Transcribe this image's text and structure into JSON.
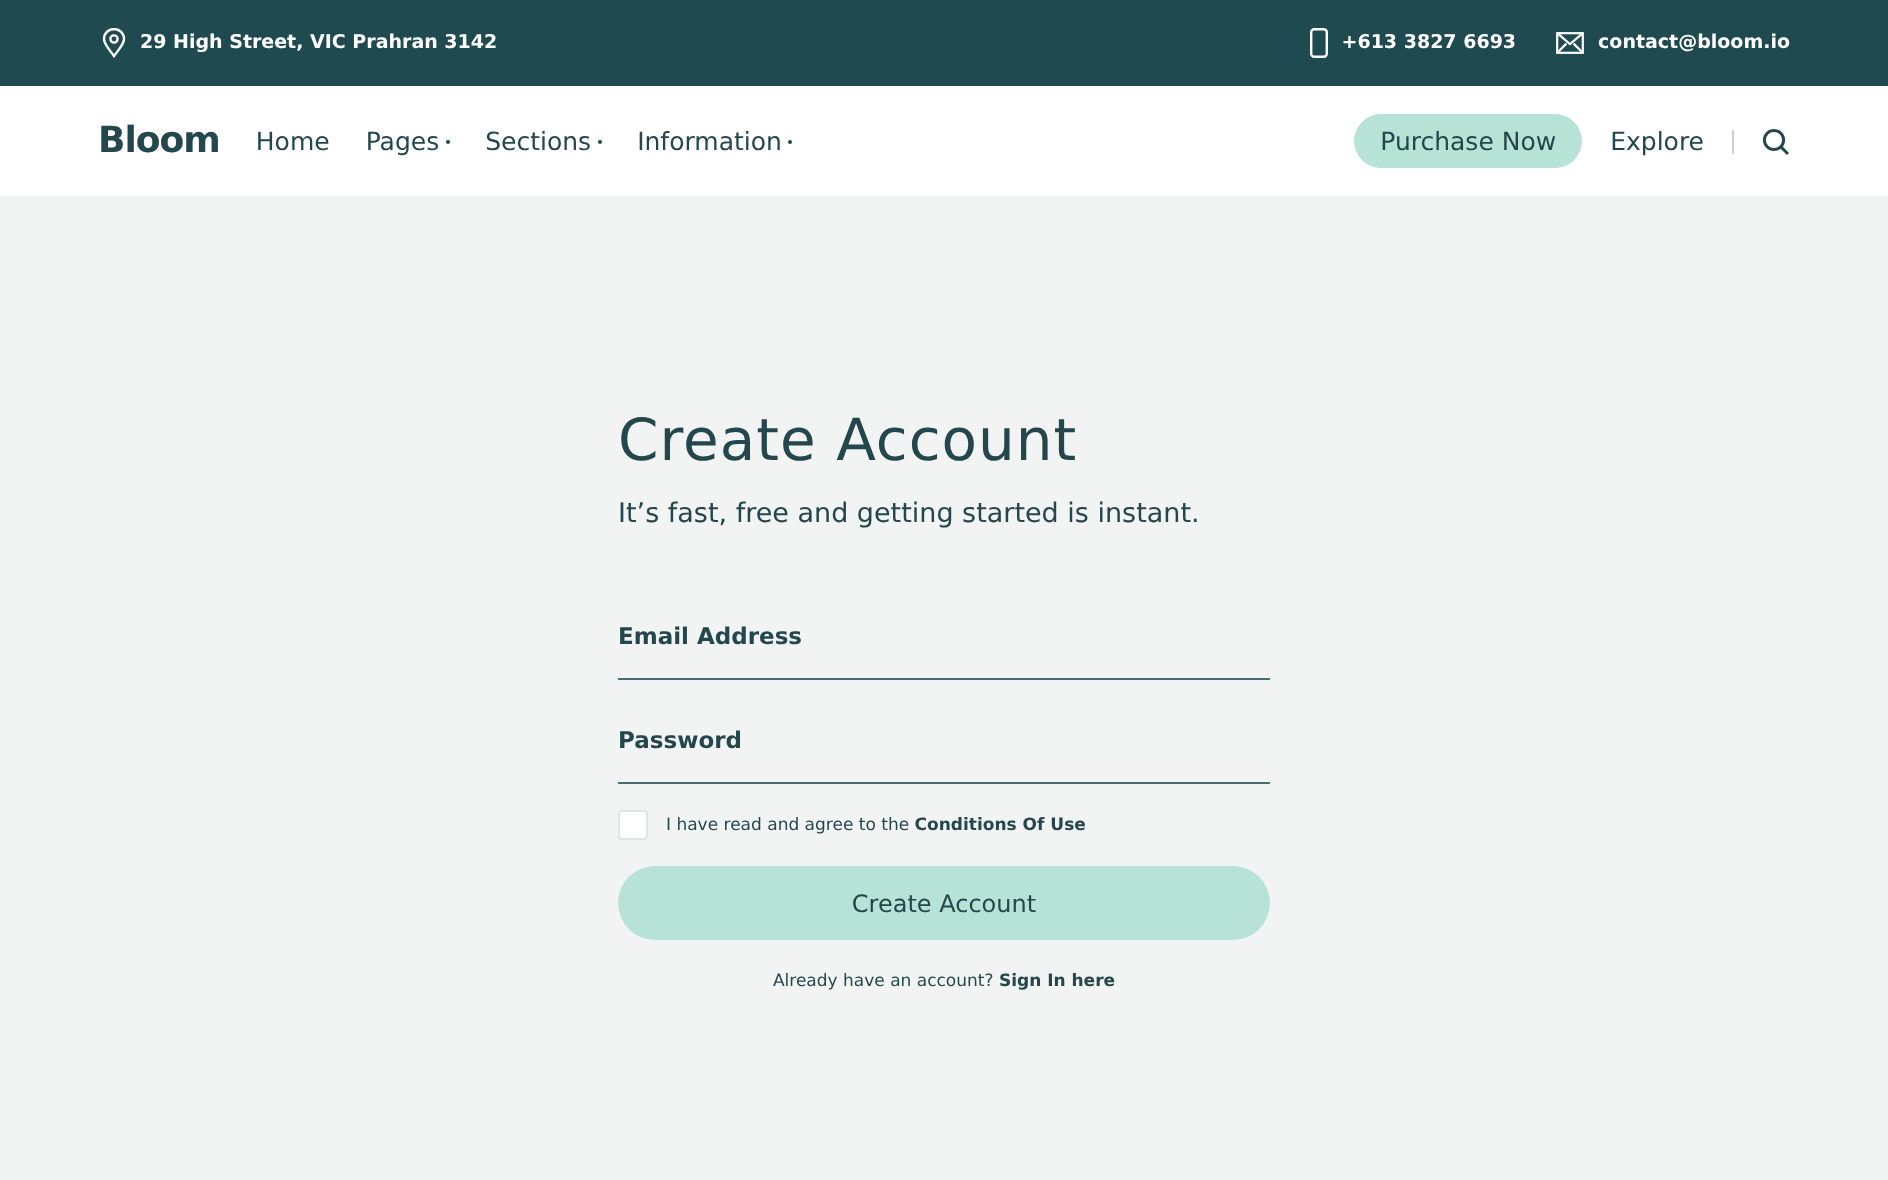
{
  "top_bar": {
    "address": "29 High Street, VIC Prahran 3142",
    "phone": "+613 3827 6693",
    "email": "contact@bloom.io"
  },
  "nav": {
    "logo": "Bloom",
    "items": [
      {
        "label": "Home",
        "has_menu": false
      },
      {
        "label": "Pages",
        "has_menu": true
      },
      {
        "label": "Sections",
        "has_menu": true
      },
      {
        "label": "Information",
        "has_menu": true
      }
    ],
    "purchase_button": "Purchase Now",
    "explore_link": "Explore"
  },
  "form": {
    "title": "Create Account",
    "subtitle": "It’s fast, free and getting started is instant.",
    "fields": [
      {
        "placeholder": "Email Address"
      },
      {
        "placeholder": "Password"
      }
    ],
    "agree": {
      "checked": false,
      "text": "I have read and agree to the",
      "link": "Conditions Of Use"
    },
    "submit": "Create Account",
    "signin": {
      "text": "Already have an account?",
      "link": "Sign In here"
    }
  }
}
